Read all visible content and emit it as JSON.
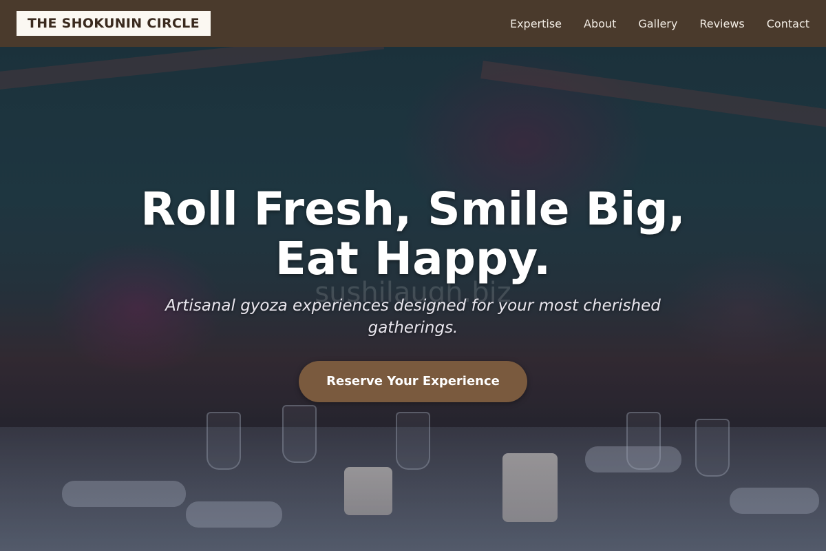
{
  "header": {
    "logo_text": "THE SHOKUNIN CIRCLE",
    "nav": [
      {
        "label": "Expertise"
      },
      {
        "label": "About"
      },
      {
        "label": "Gallery"
      },
      {
        "label": "Reviews"
      },
      {
        "label": "Contact"
      }
    ]
  },
  "hero": {
    "headline": "Roll Fresh, Smile Big, Eat Happy.",
    "watermark": "sushilaugh.biz",
    "subtitle": "Artisanal gyoza experiences designed for your most cherished gatherings.",
    "cta_label": "Reserve Your Experience",
    "background_image": "evening-table-setting-with-flowers-and-candles"
  },
  "colors": {
    "navbar_bg": "#4a3a2c",
    "logo_bg": "#fbf8f2",
    "cta_bg": "#7a5a3e",
    "text_light": "#ffffff"
  }
}
